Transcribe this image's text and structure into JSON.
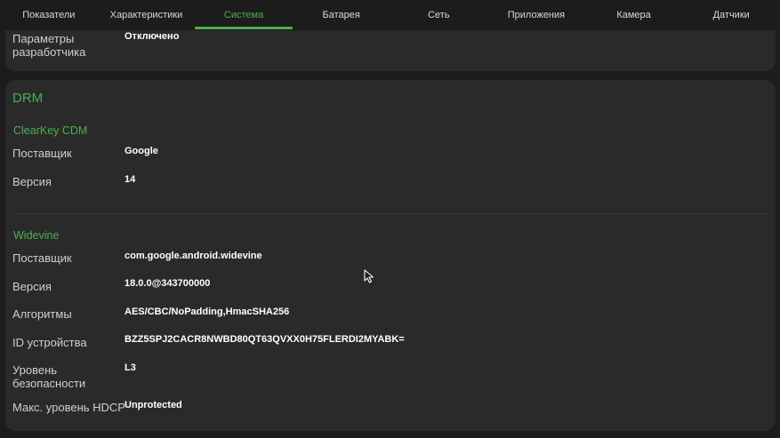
{
  "tabs": [
    {
      "label": "Показатели"
    },
    {
      "label": "Характеристики"
    },
    {
      "label": "Система",
      "active": true
    },
    {
      "label": "Батарея"
    },
    {
      "label": "Сеть"
    },
    {
      "label": "Приложения"
    },
    {
      "label": "Камера"
    },
    {
      "label": "Датчики"
    }
  ],
  "dev_options": {
    "label": "Параметры разработчика",
    "value": "Отключено"
  },
  "drm": {
    "title": "DRM",
    "clearkey": {
      "title": "ClearKey CDM",
      "vendor_label": "Поставщик",
      "vendor_value": "Google",
      "version_label": "Версия",
      "version_value": "14"
    },
    "widevine": {
      "title": "Widevine",
      "vendor_label": "Поставщик",
      "vendor_value": "com.google.android.widevine",
      "version_label": "Версия",
      "version_value": "18.0.0@343700000",
      "algorithms_label": "Алгоритмы",
      "algorithms_value": "AES/CBC/NoPadding,HmacSHA256",
      "device_id_label": "ID устройства",
      "device_id_value": "BZZ5SPJ2CACR8NWBD80QT63QVXX0H75FLERDI2MYABK=",
      "security_level_label": "Уровень безопасности",
      "security_level_value": "L3",
      "hdcp_label": "Макс. уровень HDCP",
      "hdcp_value": "Unprotected"
    }
  },
  "colors": {
    "accent": "#4caf50",
    "background": "#1c1c1c",
    "card": "#2a2a2a"
  }
}
